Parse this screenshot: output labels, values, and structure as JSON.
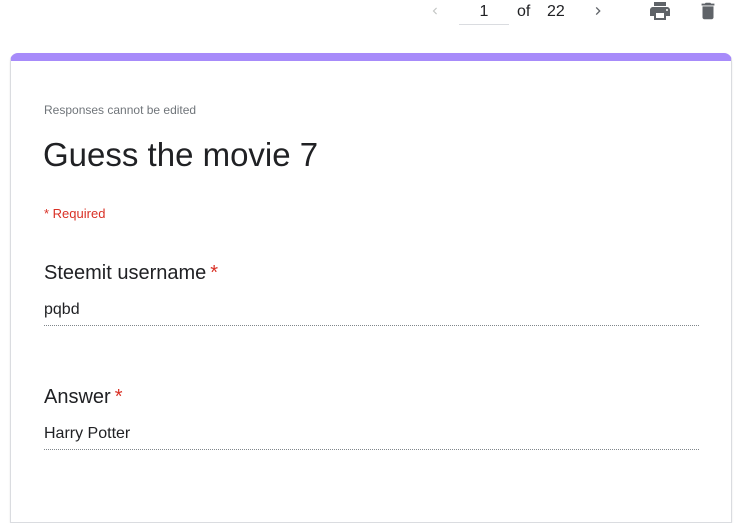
{
  "pager": {
    "current_page": "1",
    "of_label": "of",
    "total_pages": "22"
  },
  "icons": {
    "prev": "chevron-left-icon",
    "next": "chevron-right-icon",
    "print": "print-icon",
    "delete": "trash-icon"
  },
  "form": {
    "notice": "Responses cannot be edited",
    "title": "Guess the movie 7",
    "required_note": "* Required",
    "accent_color": "#a78bfa",
    "required_color": "#d93025",
    "questions": [
      {
        "label": "Steemit username",
        "required_mark": "*",
        "answer": "pqbd"
      },
      {
        "label": "Answer",
        "required_mark": "*",
        "answer": "Harry Potter"
      }
    ]
  }
}
